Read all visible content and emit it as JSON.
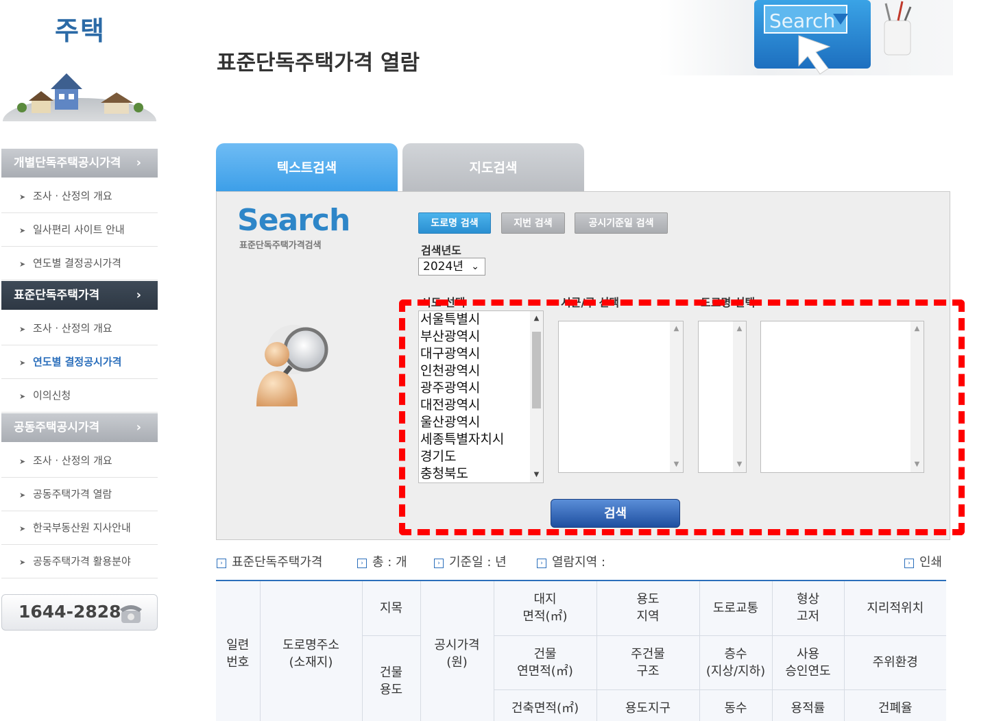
{
  "sidebar": {
    "title": "주택",
    "menus": [
      {
        "label": "개별단독주택공시가격",
        "chevron": "›"
      },
      {
        "label": "표준단독주택가격",
        "chevron": "›"
      },
      {
        "label": "공동주택공시가격",
        "chevron": "›"
      }
    ],
    "items": [
      "조사 · 산정의 개요",
      "일사편리 사이트 안내",
      "연도별 결정공시가격",
      "조사 · 산정의 개요",
      "연도별 결정공시가격",
      "이의신청",
      "조사 · 산정의 개요",
      "공동주택가격 열람",
      "한국부동산원 지사안내",
      "공동주택가격 활용분야"
    ],
    "phone": "1644-2828"
  },
  "header": {
    "title": "표준단독주택가격 열람",
    "illus_text": "Search"
  },
  "tabs": [
    "텍스트검색",
    "지도검색"
  ],
  "search": {
    "logo": "Search",
    "logo_sub": "표준단독주택가격검색",
    "type_buttons": [
      "도로명 검색",
      "지번 검색",
      "공시기준일 검색"
    ],
    "year_label": "검색년도",
    "year_value": "2024년",
    "col_labels": [
      "시도 선택",
      "시군/구 선택",
      "도로명 선택"
    ],
    "sido_options": [
      "서울특별시",
      "부산광역시",
      "대구광역시",
      "인천광역시",
      "광주광역시",
      "대전광역시",
      "울산광역시",
      "세종특별자치시",
      "경기도",
      "충청북도"
    ],
    "search_button": "검색"
  },
  "info_bar": {
    "type": "표준단독주택가격",
    "total": "총 : 개",
    "base_date": "기준일 : 년",
    "region": "열람지역 :",
    "print": "인쇄"
  },
  "table_headers": {
    "serial": "일련\n번호",
    "address": "도로명주소\n(소재지)",
    "land_category": "지목",
    "price": "공시가격\n(원)",
    "land_area": "대지\n면적(㎡)",
    "zoning": "용도\n지역",
    "road_access": "도로교통",
    "shape": "형상\n고저",
    "geo_location": "지리적위치",
    "building_use": "건물\n용도",
    "floor_area": "건물\n연면적(㎡)",
    "structure": "주건물\n구조",
    "floors": "층수\n(지상/지하)",
    "approval_year": "사용\n승인연도",
    "surroundings": "주위환경",
    "building_area": "건축면적(㎡)",
    "use_district": "용도지구",
    "units": "동수",
    "far": "용적률",
    "bcr": "건폐율"
  },
  "colors": {
    "accent_blue": "#2a6ebb",
    "tab_active": "#3b9ee8",
    "highlight": "#ff0000"
  }
}
